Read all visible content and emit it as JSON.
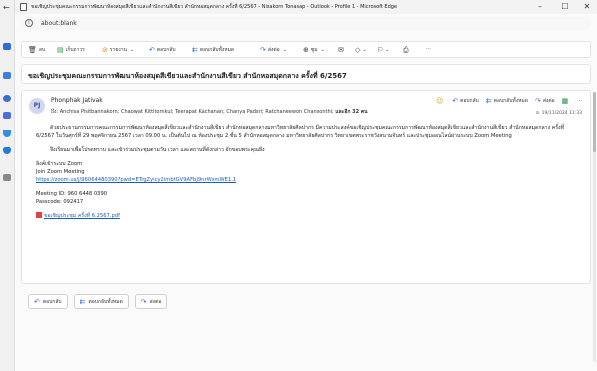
{
  "window": {
    "title": "ขอเชิญประชุมคณะกรรมการพัฒนาห้องสมุดสีเขียวและสำนักงานสีเขียว สำนักหอสมุดกลาง ครั้งที่ 6/2567 - Nisakorn Tonasap - Outlook - Profile 1 - Microsoft Edge",
    "minimize": "–",
    "maximize": "☐",
    "close": "✕"
  },
  "address": {
    "url": "about:blank"
  },
  "toolbar": {
    "delete": "ลบ",
    "archive": "เก็บถาวร",
    "report": "รายงาน",
    "reply": "ตอบกลับ",
    "reply_all": "ตอบกลับทั้งหมด",
    "forward": "ส่งต่อ",
    "zoom": "ซูม",
    "more": "···"
  },
  "subject": "ขอเชิญประชุมคณะกรรมการพัฒนาห้องสมุดสีเขียวและสำนักงานสีเขียว สำนักหอสมุดกลาง ครั้งที่ 6/2567",
  "message": {
    "avatar_initials": "PJ",
    "sender": "Phonphak Jativak",
    "to_label": "ถึง:",
    "recipients": "Anchisa Pisitbannakorn;  Chaowat Kittitornkul;  Teerapat Kachanan;  Chanya Padsri;  Ratchaneewon Chansonthi;",
    "more_recipients": "และอีก 32 คน",
    "date": "อ. 19/11/2024 11:33",
    "actions": {
      "reply": "ตอบกลับ",
      "reply_all": "ตอบกลับทั้งหมด",
      "forward": "ส่งต่อ",
      "more": "···"
    },
    "body": {
      "p1": "ด้วยประธานกรรมการคณะกรรมการพัฒนาห้องสมุดสีเขียวและสำนักงานสีเขียว สำนักหอสมุดกลางมหาวิทยาลัยศิลปากร มีความประสงค์ขอเชิญประชุมคณะกรรมการพัฒนาห้องสมุดสีเขียวและสำนักงานสีเขียว สำนักหอสมุดกลาง ครั้งที่ 6/2567 ในวันศุกร์ที่ 29 พฤศจิกายน 2567 เวลา 09.00 น. เป็นต้นไป ณ ห้องประชุม 2 ชั้น 5 สำนักหอสมุดกลาง มหาวิทยาลัยศิลปากร วิทยาเขตพระราชวังสนามจันทร์ และประชุมออนไลน์ผ่านระบบ Zoom Meeting",
      "p2": "จึงเรียนมาเพื่อโปรดทราบ และเข้าร่วมประชุมตามวัน เวลา และสถานที่ดังกล่าว จักขอบพระคุณยิ่ง",
      "zoom_heading": "ลิงค์เข้าระบบ Zoom",
      "join": "Join Zoom Meeting",
      "zoom_link": "https://zoom.us/j/96064480390?pwd=ETrgZyicy2imbtGV9AFbJ9nrWsmWE1.1",
      "meeting_id": "Meeting ID: 960 6448 0390",
      "passcode": "Passcode: 092417",
      "attachment": "ขอเชิญประชุม ครั้งที่ 6.2567.pdf"
    }
  },
  "reply_buttons": {
    "reply": "ตอบกลับ",
    "reply_all": "ตอบกลับทั้งหมด",
    "forward": "ส่งต่อ"
  },
  "colors": {
    "accent": "#3a66c4",
    "link": "#1a5fb4"
  }
}
